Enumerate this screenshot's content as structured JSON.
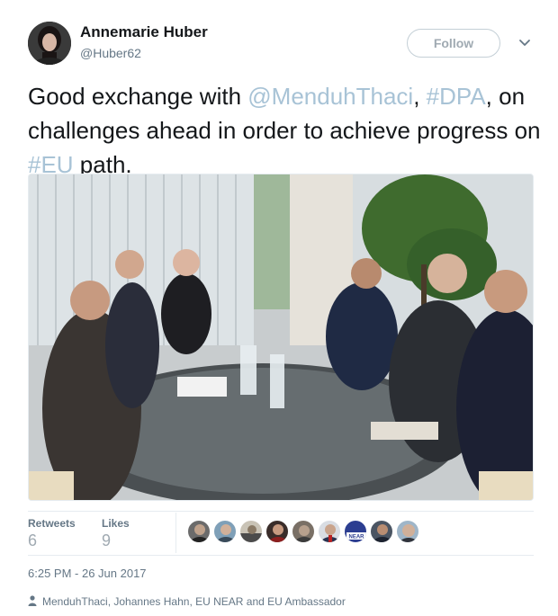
{
  "author": {
    "name": "Annemarie Huber",
    "handle": "@Huber62"
  },
  "follow_button": {
    "label": "Follow"
  },
  "tweet": {
    "parts": [
      {
        "text": "Good exchange with ",
        "link": false
      },
      {
        "text": "@MenduhThaci",
        "link": true
      },
      {
        "text": ", ",
        "link": false
      },
      {
        "text": "#DPA",
        "link": true
      },
      {
        "text": ", on challenges ahead in order to achieve progress on ",
        "link": false
      },
      {
        "text": "#EU",
        "link": true
      },
      {
        "text": " path.",
        "link": false
      }
    ]
  },
  "photo": {
    "icon": "meeting-photo"
  },
  "stats": {
    "retweets_label": "Retweets",
    "retweets_value": "6",
    "likes_label": "Likes",
    "likes_value": "9"
  },
  "likers": [
    {
      "icon": "avatar-1",
      "color": "#6b6b6b"
    },
    {
      "icon": "avatar-2",
      "color": "#7fa0b8"
    },
    {
      "icon": "avatar-3",
      "color": "#c9c3b6"
    },
    {
      "icon": "avatar-4",
      "color": "#3a2d2a"
    },
    {
      "icon": "avatar-5",
      "color": "#7a7066"
    },
    {
      "icon": "avatar-6",
      "color": "#d9dde3"
    },
    {
      "icon": "avatar-near",
      "color": "#2c3e91",
      "text": "NEAR"
    },
    {
      "icon": "avatar-8",
      "color": "#4b5563"
    },
    {
      "icon": "avatar-9",
      "color": "#9fb6c9"
    }
  ],
  "timestamp": "6:25 PM - 26 Jun 2017",
  "context": {
    "icon": "person-icon",
    "text": "MenduhThaci, Johannes Hahn, EU NEAR and EU Ambassador"
  },
  "colors": {
    "text": "#14171a",
    "secondary": "#657786",
    "link": "#a8c3d6",
    "border": "#e6ecf0"
  }
}
